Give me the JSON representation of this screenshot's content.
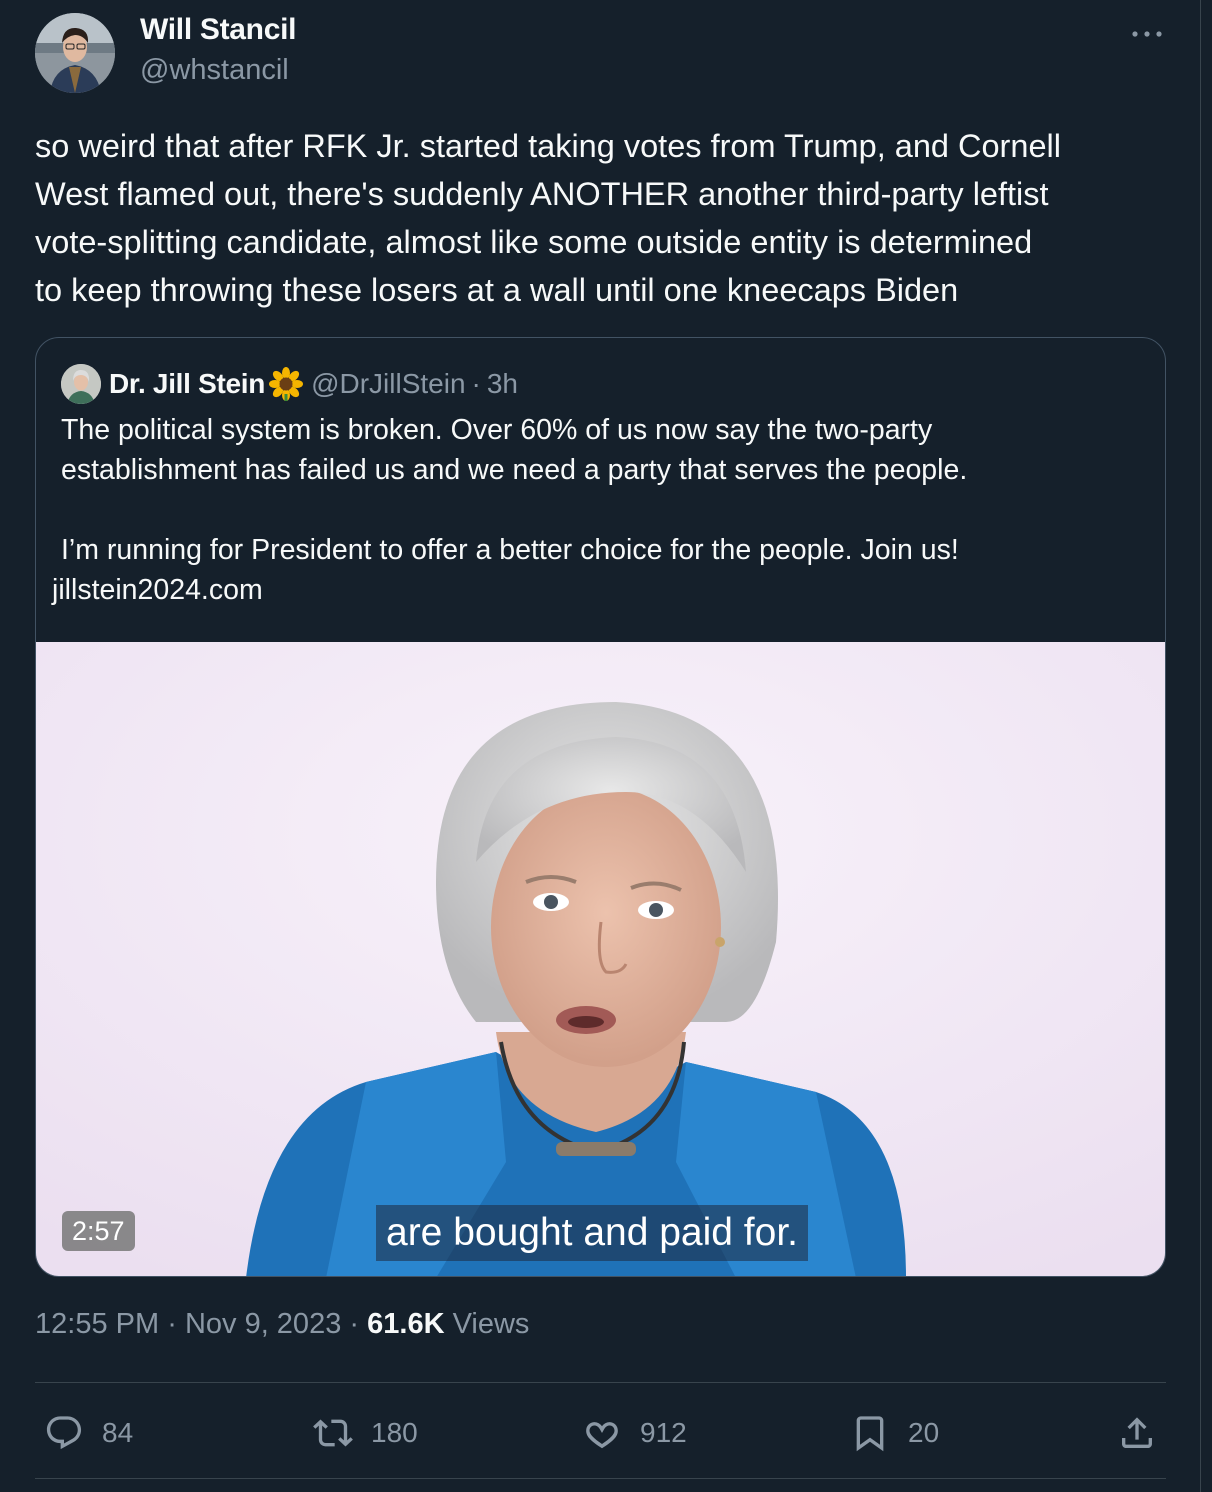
{
  "tweet": {
    "author": {
      "name": "Will Stancil",
      "handle": "@whstancil"
    },
    "text_lines": [
      "so weird that after RFK Jr. started taking votes from Trump, and Cornell",
      "West flamed out, there's suddenly ANOTHER another third-party leftist",
      "vote-splitting candidate, almost like some outside entity is determined",
      "to keep throwing these losers at a wall until one kneecaps Biden"
    ],
    "time": "12:55 PM",
    "date": "Nov 9, 2023",
    "views_count": "61.6K",
    "views_label": "Views",
    "separator": "·"
  },
  "quote": {
    "author": {
      "name": "Dr. Jill Stein",
      "handle": "@DrJillStein",
      "time": "3h"
    },
    "text_lines": [
      "The political system is broken. Over 60% of us now say the two-party",
      "establishment has failed us and we need a party that serves the people.",
      "",
      "I’m running for President to offer a better choice for the people. Join us!",
      "jillstein2024.com"
    ],
    "video": {
      "duration": "2:57",
      "caption": "are bought and paid for."
    }
  },
  "actions": {
    "replies": "84",
    "retweets": "180",
    "likes": "912",
    "bookmarks": "20"
  },
  "icons": {
    "more": "more-dots-icon",
    "reply": "reply-icon",
    "retweet": "retweet-icon",
    "like": "heart-icon",
    "bookmark": "bookmark-icon",
    "share": "share-icon",
    "verified_emoji": "sunflower-icon"
  },
  "colors": {
    "background": "#15202b",
    "text": "#f7f9f9",
    "secondary": "#8b98a5",
    "border": "#38444d"
  }
}
